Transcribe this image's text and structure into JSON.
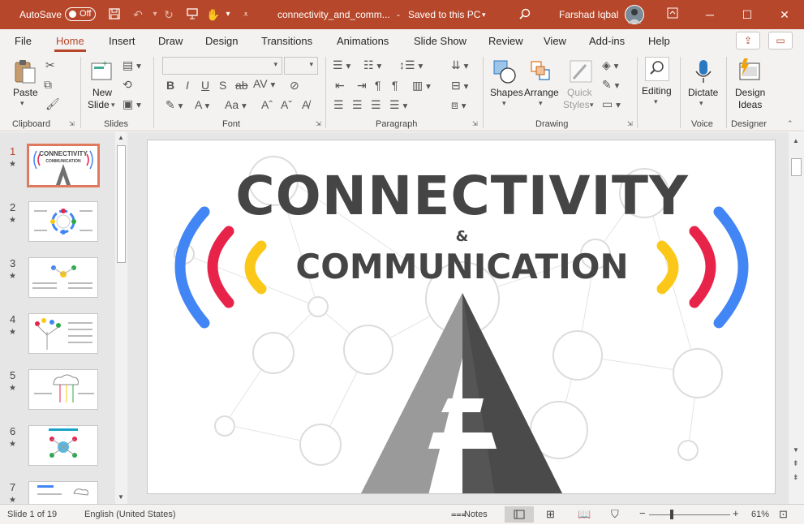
{
  "titlebar": {
    "autosave_label": "AutoSave",
    "autosave_state": "Off",
    "filename": "connectivity_and_comm...",
    "save_status": "Saved to this PC",
    "user_name": "Farshad Iqbal"
  },
  "tabs": [
    "File",
    "Home",
    "Insert",
    "Draw",
    "Design",
    "Transitions",
    "Animations",
    "Slide Show",
    "Review",
    "View",
    "Add-ins",
    "Help"
  ],
  "active_tab": "Home",
  "ribbon": {
    "clipboard": {
      "group": "Clipboard",
      "paste": "Paste"
    },
    "slides": {
      "group": "Slides",
      "new_slide_1": "New",
      "new_slide_2": "Slide"
    },
    "font": {
      "group": "Font"
    },
    "paragraph": {
      "group": "Paragraph"
    },
    "drawing": {
      "group": "Drawing",
      "shapes": "Shapes",
      "arrange": "Arrange",
      "quick_styles_1": "Quick",
      "quick_styles_2": "Styles"
    },
    "editing": {
      "label": "Editing"
    },
    "voice": {
      "group": "Voice",
      "dictate": "Dictate"
    },
    "designer": {
      "group": "Designer",
      "design_ideas_1": "Design",
      "design_ideas_2": "Ideas"
    }
  },
  "thumbnails": [
    {
      "num": "1",
      "star": "★"
    },
    {
      "num": "2",
      "star": "★"
    },
    {
      "num": "3",
      "star": "★"
    },
    {
      "num": "4",
      "star": "★"
    },
    {
      "num": "5",
      "star": "★"
    },
    {
      "num": "6",
      "star": "★"
    },
    {
      "num": "7",
      "star": "★"
    }
  ],
  "slide": {
    "title": "CONNECTIVITY",
    "ampersand": "&",
    "subtitle": "COMMUNICATION"
  },
  "status": {
    "slide_info": "Slide 1 of 19",
    "language": "English (United States)",
    "notes": "Notes",
    "zoom": "61%"
  },
  "colors": {
    "accent": "#b7472a",
    "blue": "#4285f4",
    "red": "#e8234a",
    "yellow": "#fbc81a",
    "dark_gray": "#454545"
  }
}
